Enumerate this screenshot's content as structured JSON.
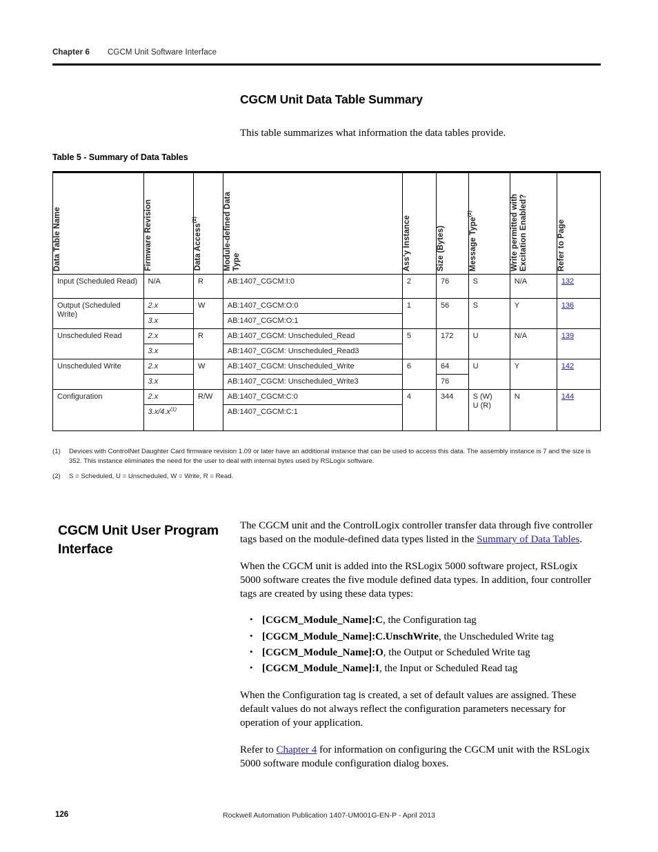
{
  "running_header": {
    "chapter": "Chapter 6",
    "chapter_title": "CGCM Unit Software Interface"
  },
  "section1": {
    "heading": "CGCM Unit Data Table Summary",
    "intro": "This table summarizes what information the data tables provide.",
    "table_caption": "Table 5 - Summary of Data Tables"
  },
  "table": {
    "headers": {
      "data_table_name": "Data Table Name",
      "firmware_revision": "Firmware Revision",
      "data_access": "Data Access",
      "data_access_sup": "(2)",
      "module_defined_data_type": "Module-defined Data\nType",
      "assy_instance": "Ass'y Instance",
      "size_bytes": "Size (Bytes)",
      "message_type": "Message Type",
      "message_type_sup": "(2)",
      "write_permitted": "Write permitted with\nExcitation Enabled?",
      "refer_to_page": "Refer to Page"
    },
    "rows": [
      {
        "name": "Input (Scheduled Read)",
        "firmware": [
          "N/A"
        ],
        "access": "R",
        "types": [
          "AB:1407_CGCM:I:0"
        ],
        "assy": "2",
        "size": [
          "76"
        ],
        "message": "S",
        "write_permitted": "N/A",
        "page": "132"
      },
      {
        "name": "Output (Scheduled Write)",
        "firmware": [
          "2.x",
          "3.x"
        ],
        "access": "W",
        "types": [
          "AB:1407_CGCM:O:0",
          "AB:1407_CGCM:O:1"
        ],
        "assy": "1",
        "size": [
          "56"
        ],
        "message": "S",
        "write_permitted": "Y",
        "page": "136"
      },
      {
        "name": "Unscheduled Read",
        "firmware": [
          "2.x",
          "3.x"
        ],
        "access": "R",
        "types": [
          "AB:1407_CGCM: Unscheduled_Read",
          "AB:1407_CGCM: Unscheduled_Read3"
        ],
        "assy": "5",
        "size": [
          "172"
        ],
        "message": "U",
        "write_permitted": "N/A",
        "page": "139"
      },
      {
        "name": "Unscheduled Write",
        "firmware": [
          "2.x",
          "3.x"
        ],
        "access": "W",
        "types": [
          "AB:1407_CGCM: Unscheduled_Write",
          "AB:1407_CGCM: Unscheduled_Write3"
        ],
        "assy": "6",
        "size": [
          "64",
          "76"
        ],
        "message": "U",
        "write_permitted": "Y",
        "page": "142"
      },
      {
        "name": "Configuration",
        "firmware": [
          "2.x",
          "3.x/4.x(1)"
        ],
        "access": "R/W",
        "types": [
          "AB:1407_CGCM:C:0",
          "AB:1407_CGCM:C:1"
        ],
        "assy": "4",
        "size": [
          "344"
        ],
        "message": "S (W)\nU (R)",
        "write_permitted": "N",
        "page": "144"
      }
    ]
  },
  "footnotes": [
    {
      "mark": "(1)",
      "text": "Devices with ControlNet Daughter Card firmware revision 1.09 or later have an additional instance that can be used to access this data. The assembly instance is 7 and the size is 352. This instance eliminates the need for the user to deal with internal bytes used by RSLogix software."
    },
    {
      "mark": "(2)",
      "text": "S = Scheduled, U = Unscheduled, W = Write, R = Read."
    }
  ],
  "section2": {
    "heading": "CGCM Unit User Program Interface",
    "para1_before": "The CGCM unit and the ControlLogix controller transfer data through five controller tags based on the module-defined data types listed in the ",
    "para1_link": "Summary of Data Tables",
    "para1_after": ".",
    "para2": "When the CGCM unit is added into the RSLogix 5000 software project, RSLogix 5000 software creates the five module defined data types. In addition, four controller tags are created by using these data types:",
    "bullets": [
      {
        "tag": "[CGCM_Module_Name]:C",
        "desc": ", the Configuration tag"
      },
      {
        "tag": "[CGCM_Module_Name]:C.UnschWrite",
        "desc": ", the Unscheduled Write tag"
      },
      {
        "tag": "[CGCM_Module_Name]:O",
        "desc": ", the Output or Scheduled Write tag"
      },
      {
        "tag": "[CGCM_Module_Name]:I",
        "desc": ", the Input or Scheduled Read tag"
      }
    ],
    "para3": "When the Configuration tag is created, a set of default values are assigned. These default values do not always reflect the configuration parameters necessary for operation of your application.",
    "para4_before": "Refer to ",
    "para4_link": "Chapter 4",
    "para4_after": " for information on configuring the CGCM unit with the RSLogix 5000 software module configuration dialog boxes."
  },
  "footer": {
    "page_number": "126",
    "publication": "Rockwell Automation Publication 1407-UM001G-EN-P - April 2013"
  },
  "colors": {
    "link": "#2020d0",
    "text": "#231f20",
    "rule": "#000000"
  }
}
